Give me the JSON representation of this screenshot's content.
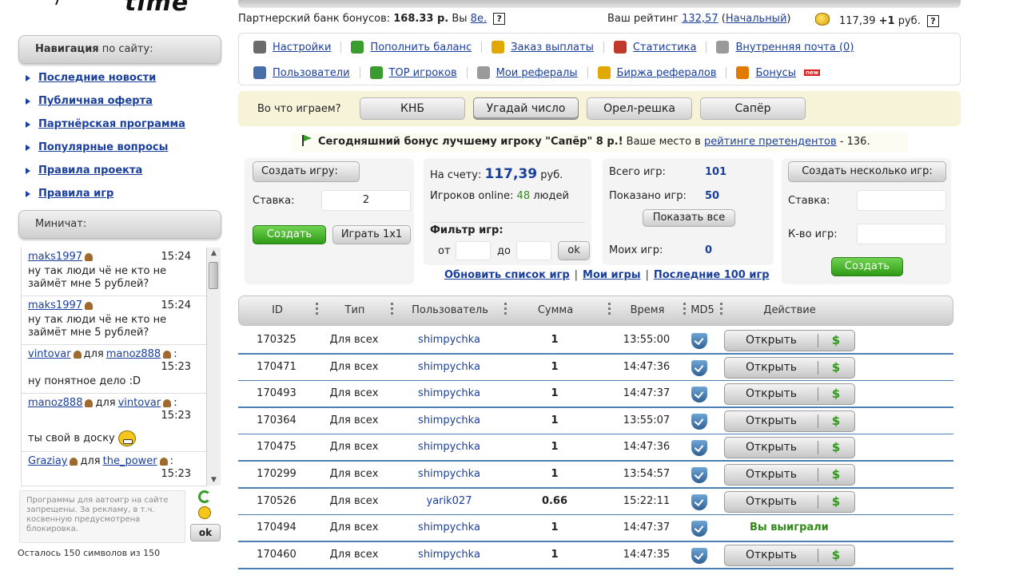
{
  "logo": {
    "text": "time"
  },
  "nav": {
    "title_bold": "Навигация",
    "title_rest": " по сайту:",
    "items": [
      "Последние новости",
      "Публичная оферта",
      "Партнёрская программа",
      "Популярные вопросы",
      "Правила проекта",
      "Правила игр"
    ]
  },
  "chat": {
    "title": "Миничат:",
    "messages": [
      {
        "from": "maks1997",
        "to": "",
        "time": "15:24",
        "text": "ну так люди чё не кто не займёт мне 5 рублей?"
      },
      {
        "from": "maks1997",
        "to": "",
        "time": "15:24",
        "text": "ну так люди чё не кто не займёт мне 5 рублей?"
      },
      {
        "from": "vintovar",
        "to": "manoz888",
        "time": "15:23",
        "text": "ну понятное дело :D"
      },
      {
        "from": "manoz888",
        "to": "vintovar",
        "time": "15:23",
        "text": "ты свой в доску"
      },
      {
        "from": "Graziay",
        "to": "the_power",
        "time": "15:23",
        "text": ""
      }
    ],
    "for_word": "для",
    "input_placeholder": "Программы для автоигр на сайте запрещены. За рекламу, в т.ч. косвенную предусмотрена блокировка.",
    "ok_label": "ok",
    "chars_left": "Осталось 150 символов из 150"
  },
  "header": {
    "bonus_label": "Партнерский банк бонусов:",
    "bonus_value": "168.33 р.",
    "you_label": "Вы",
    "you_link": "8е.",
    "help": "?",
    "rating_label": "Ваш рейтинг",
    "rating_value": "132,57",
    "rating_level": "Начальный",
    "balance": "117,39",
    "balance_plus": "+1",
    "balance_unit": "руб.",
    "balance_help": "?"
  },
  "menu": {
    "row1": [
      {
        "label": "Настройки",
        "icon": "wrench-icon",
        "color": "#6b6b6b"
      },
      {
        "label": "Пополнить баланс",
        "icon": "money-icon",
        "color": "#3a9b2e"
      },
      {
        "label": "Заказ выплаты",
        "icon": "coins-icon",
        "color": "#e0a800"
      },
      {
        "label": "Статистика",
        "icon": "chart-icon",
        "color": "#c0392b"
      },
      {
        "label": "Внутренняя почта (0)",
        "icon": "mail-icon",
        "color": "#9a9a9a"
      }
    ],
    "row2": [
      {
        "label": "Пользователи",
        "icon": "search-icon",
        "color": "#4a6ea8"
      },
      {
        "label": "TOP игроков",
        "icon": "arrow-up-icon",
        "color": "#3a9b2e"
      },
      {
        "label": "Мои рефералы",
        "icon": "users-icon",
        "color": "#9a9a9a"
      },
      {
        "label": "Биржа рефералов",
        "icon": "exchange-icon",
        "color": "#e0a800"
      },
      {
        "label": "Бонусы",
        "icon": "gift-icon",
        "color": "#e07b00",
        "badge": "new"
      }
    ]
  },
  "games": {
    "label": "Во что играем?",
    "options": [
      "КНБ",
      "Угадай число",
      "Орел-решка",
      "Сапёр"
    ],
    "active": "Угадай число"
  },
  "today_bonus": {
    "bold": "Сегодняшний бонус лучшему игроку \"Сапёр\" 8 р.!",
    "place_text": "Ваше место в",
    "place_link": "рейтинге претендентов",
    "place_value": "- 136."
  },
  "create_game": {
    "title": "Создать игру:",
    "stake_label": "Ставка:",
    "stake_value": "2",
    "create_btn": "Создать",
    "play_btn": "Играть 1x1"
  },
  "account": {
    "balance_label": "На счету:",
    "balance_value": "117,39",
    "balance_unit": "руб.",
    "online_label": "Игроков online:",
    "online_value": "48",
    "online_unit": "людей",
    "filter_label": "Фильтр игр:",
    "from_label": "от",
    "to_label": "до",
    "ok_btn": "ok"
  },
  "games_count": {
    "total_label": "Всего игр:",
    "total_value": "101",
    "shown_label": "Показано игр:",
    "shown_value": "50",
    "show_all_btn": "Показать все",
    "mine_label": "Моих игр:",
    "mine_value": "0"
  },
  "multi_create": {
    "title": "Создать несколько игр:",
    "stake_label": "Ставка:",
    "count_label": "К-во игр:",
    "create_btn": "Создать"
  },
  "list_links": [
    "Обновить список игр",
    "Мои игры",
    "Последние 100 игр"
  ],
  "table": {
    "headers": [
      "ID",
      "Тип",
      "Пользователь",
      "Сумма",
      "Время",
      "MD5",
      "Действие"
    ],
    "open_label": "Открыть",
    "dollar": "$",
    "won_label": "Вы выиграли",
    "rows": [
      {
        "id": "170325",
        "type": "Для всех",
        "user": "shimpychka",
        "sum": "1",
        "time": "13:55:00",
        "action": "open"
      },
      {
        "id": "170471",
        "type": "Для всех",
        "user": "shimpychka",
        "sum": "1",
        "time": "14:47:36",
        "action": "open"
      },
      {
        "id": "170493",
        "type": "Для всех",
        "user": "shimpychka",
        "sum": "1",
        "time": "14:47:37",
        "action": "open"
      },
      {
        "id": "170364",
        "type": "Для всех",
        "user": "shimpychka",
        "sum": "1",
        "time": "13:55:07",
        "action": "open"
      },
      {
        "id": "170475",
        "type": "Для всех",
        "user": "shimpychka",
        "sum": "1",
        "time": "14:47:36",
        "action": "open"
      },
      {
        "id": "170299",
        "type": "Для всех",
        "user": "shimpychka",
        "sum": "1",
        "time": "13:54:57",
        "action": "open"
      },
      {
        "id": "170526",
        "type": "Для всех",
        "user": "yarik027",
        "sum": "0.66",
        "time": "15:22:11",
        "action": "open"
      },
      {
        "id": "170494",
        "type": "Для всех",
        "user": "shimpychka",
        "sum": "1",
        "time": "14:47:37",
        "action": "won"
      },
      {
        "id": "170460",
        "type": "Для всех",
        "user": "shimpychka",
        "sum": "1",
        "time": "14:47:35",
        "action": "open"
      }
    ]
  }
}
